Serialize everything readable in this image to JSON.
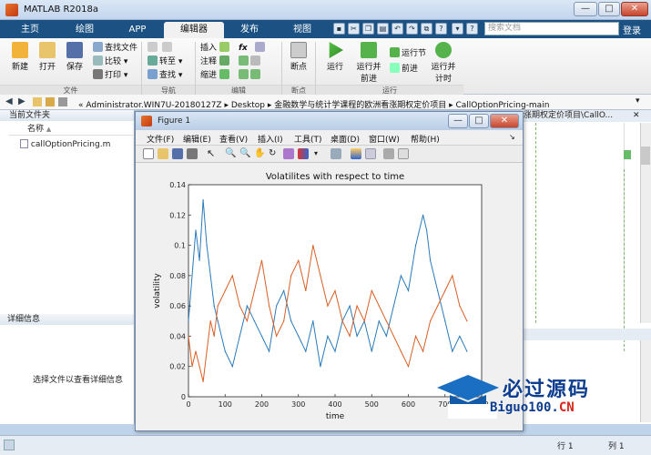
{
  "window": {
    "title": "MATLAB R2018a",
    "min": "—",
    "max": "□",
    "close": "✕"
  },
  "tabs": [
    "主页",
    "绘图",
    "APP",
    "编辑器",
    "发布",
    "视图"
  ],
  "search": {
    "placeholder": "搜索文档"
  },
  "login": "登录",
  "ribbon": {
    "new": "新建",
    "open": "打开",
    "save": "保存",
    "find_files": "查找文件",
    "compare": "比较",
    "print": "打印",
    "goto": "转至",
    "find": "查找",
    "insert": "插入",
    "comment": "注释",
    "indent": "缩进",
    "fx": "fx",
    "breakpoints": "断点",
    "run": "运行",
    "run_advance": "运行并\n前进",
    "run_section": "运行节",
    "advance": "前进",
    "run_time": "运行并\n计时",
    "groups": {
      "file": "文件",
      "nav": "导航",
      "edit": "编辑",
      "bp": "断点",
      "run": "运行"
    }
  },
  "address": {
    "prefix": "«",
    "segments": [
      "Administrator.WIN7U-20180127Z",
      "Desktop",
      "金融数学与统计学课程的欧洲看涨期权定价项目",
      "CallOptionPricing-main"
    ]
  },
  "left": {
    "current_folder": "当前文件夹",
    "name_col": "名称",
    "sort_arrow": "▲",
    "files": [
      "callOptionPricing.m"
    ],
    "details": "详细信息",
    "details_msg": "选择文件以查看详细信息"
  },
  "right": {
    "path_fragment": "涨期权定价项目\\CallO..."
  },
  "status": {
    "row_label": "行",
    "row": "1",
    "col_label": "列",
    "col": "1"
  },
  "figure": {
    "title": "Figure 1",
    "menu": [
      "文件(F)",
      "编辑(E)",
      "查看(V)",
      "插入(I)",
      "工具(T)",
      "桌面(D)",
      "窗口(W)",
      "帮助(H)"
    ],
    "menu_arrow": "↘"
  },
  "watermark": {
    "cn": "必过源码",
    "url_pre": "Biguo100.",
    "url_suffix": "CN"
  },
  "colors": {
    "accent": "#1b5283",
    "series1": "#2a7ab9",
    "series2": "#d95f25"
  },
  "chart_data": {
    "type": "line",
    "title": "Volatilites with respect to time",
    "xlabel": "time",
    "ylabel": "volatility",
    "xlim": [
      0,
      800
    ],
    "ylim": [
      0,
      0.14
    ],
    "xticks": [
      0,
      100,
      200,
      300,
      400,
      500,
      600,
      700,
      800
    ],
    "yticks": [
      0,
      0.02,
      0.04,
      0.06,
      0.08,
      0.1,
      0.12,
      0.14
    ],
    "grid": false,
    "series": [
      {
        "color": "#2a7ab9",
        "x": [
          0,
          10,
          20,
          30,
          40,
          50,
          60,
          70,
          80,
          100,
          120,
          140,
          160,
          180,
          200,
          220,
          240,
          260,
          280,
          300,
          320,
          340,
          360,
          380,
          400,
          420,
          440,
          460,
          480,
          500,
          520,
          540,
          560,
          580,
          600,
          620,
          640,
          650,
          660,
          680,
          700,
          720,
          740,
          760
        ],
        "values": [
          0.05,
          0.08,
          0.11,
          0.09,
          0.13,
          0.1,
          0.08,
          0.06,
          0.05,
          0.03,
          0.02,
          0.04,
          0.06,
          0.05,
          0.04,
          0.03,
          0.06,
          0.07,
          0.05,
          0.04,
          0.03,
          0.05,
          0.02,
          0.04,
          0.03,
          0.05,
          0.06,
          0.04,
          0.05,
          0.03,
          0.05,
          0.04,
          0.06,
          0.08,
          0.07,
          0.1,
          0.12,
          0.11,
          0.09,
          0.07,
          0.05,
          0.03,
          0.04,
          0.03
        ]
      },
      {
        "color": "#d95f25",
        "x": [
          0,
          10,
          20,
          30,
          40,
          50,
          60,
          70,
          80,
          100,
          120,
          140,
          160,
          180,
          200,
          220,
          240,
          260,
          280,
          300,
          320,
          340,
          360,
          380,
          400,
          420,
          440,
          460,
          480,
          500,
          520,
          540,
          560,
          580,
          600,
          620,
          640,
          650,
          660,
          680,
          700,
          720,
          740,
          760
        ],
        "values": [
          0.04,
          0.02,
          0.03,
          0.02,
          0.01,
          0.03,
          0.05,
          0.04,
          0.06,
          0.07,
          0.08,
          0.06,
          0.05,
          0.07,
          0.09,
          0.06,
          0.04,
          0.05,
          0.08,
          0.09,
          0.07,
          0.1,
          0.08,
          0.06,
          0.07,
          0.05,
          0.04,
          0.06,
          0.05,
          0.07,
          0.06,
          0.05,
          0.04,
          0.03,
          0.02,
          0.04,
          0.03,
          0.04,
          0.05,
          0.06,
          0.07,
          0.08,
          0.06,
          0.05
        ]
      }
    ]
  }
}
